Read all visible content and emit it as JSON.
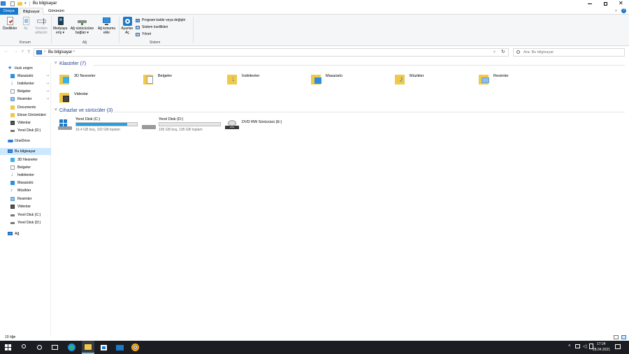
{
  "window": {
    "title": "Bu bilgisayar"
  },
  "tabs": [
    {
      "label": "Dosya"
    },
    {
      "label": "Bilgisayar"
    },
    {
      "label": "Görünüm"
    }
  ],
  "ribbon": {
    "konum": {
      "group": "Konum",
      "buttons": [
        {
          "label": "Özellikler"
        },
        {
          "label": "Aç"
        },
        {
          "label": "Yeniden\nadlandır"
        }
      ]
    },
    "ag": {
      "group": "Ağ",
      "buttons": [
        {
          "label": "Medyaya\neriş ▾"
        },
        {
          "label": "Ağ sürücüsüne\nbağlan ▾"
        },
        {
          "label": "Ağ konumu\nekle"
        }
      ]
    },
    "sistem": {
      "group": "Sistem",
      "big": {
        "label": "Ayarları\nAç"
      },
      "small": [
        {
          "label": "Program kaldır veya değiştir"
        },
        {
          "label": "Sistem özellikleri"
        },
        {
          "label": "Yönet"
        }
      ]
    }
  },
  "address": {
    "path": "Bu bilgisayar",
    "search_placeholder": "Ara: Bu bilgisayar"
  },
  "nav": {
    "quick_access": "Hızlı erişim",
    "quick_items": [
      {
        "label": "Masaüstü",
        "pinned": true
      },
      {
        "label": "İndirilenler",
        "pinned": true
      },
      {
        "label": "Belgeler",
        "pinned": true
      },
      {
        "label": "Resimler",
        "pinned": true
      },
      {
        "label": "Documents",
        "pinned": false
      },
      {
        "label": "Ekran Görüntüleri",
        "pinned": false
      },
      {
        "label": "Videolar",
        "pinned": false
      },
      {
        "label": "Yerel Disk (D:)",
        "pinned": false
      }
    ],
    "onedrive": "OneDrive",
    "this_pc": "Bu bilgisayar",
    "pc_items": [
      {
        "label": "3D Nesneler"
      },
      {
        "label": "Belgeler"
      },
      {
        "label": "İndirilenler"
      },
      {
        "label": "Masaüstü"
      },
      {
        "label": "Müzikler"
      },
      {
        "label": "Resimler"
      },
      {
        "label": "Videolar"
      },
      {
        "label": "Yerel Disk (C:)"
      },
      {
        "label": "Yerel Disk (D:)"
      }
    ],
    "network": "Ağ"
  },
  "content": {
    "folders_header": "Klasörler (7)",
    "folders": [
      {
        "label": "3D Nesneler",
        "icon": "3d-objects-icon"
      },
      {
        "label": "Belgeler",
        "icon": "documents-icon"
      },
      {
        "label": "İndirilenler",
        "icon": "downloads-icon"
      },
      {
        "label": "Masaüstü",
        "icon": "desktop-icon"
      },
      {
        "label": "Müzikler",
        "icon": "music-icon"
      },
      {
        "label": "Resimler",
        "icon": "pictures-icon"
      },
      {
        "label": "Videolar",
        "icon": "videos-icon"
      }
    ],
    "drives_header": "Cihazlar ve sürücüler (3)",
    "drives": [
      {
        "label": "Yerel Disk (C:)",
        "info": "16,4 GB boş, 102 GB toplam",
        "used_fraction": 0.84,
        "bar_color": "#26a0da"
      },
      {
        "label": "Yerel Disk (D:)",
        "info": "195 GB boş, 195 GB toplam",
        "used_fraction": 0.0,
        "bar_color": "#26a0da"
      },
      {
        "label": "DVD RW Sürücüsü (E:)",
        "info": "",
        "used_fraction": null
      }
    ]
  },
  "status": {
    "count": "10 öğe"
  },
  "taskbar": {
    "time": "17:24",
    "date": "28.04.2021"
  },
  "colors": {
    "accent": "#1979ca",
    "selected": "#cce8ff",
    "header_text": "#1e3f8f",
    "taskbar": "#1c1d22"
  }
}
